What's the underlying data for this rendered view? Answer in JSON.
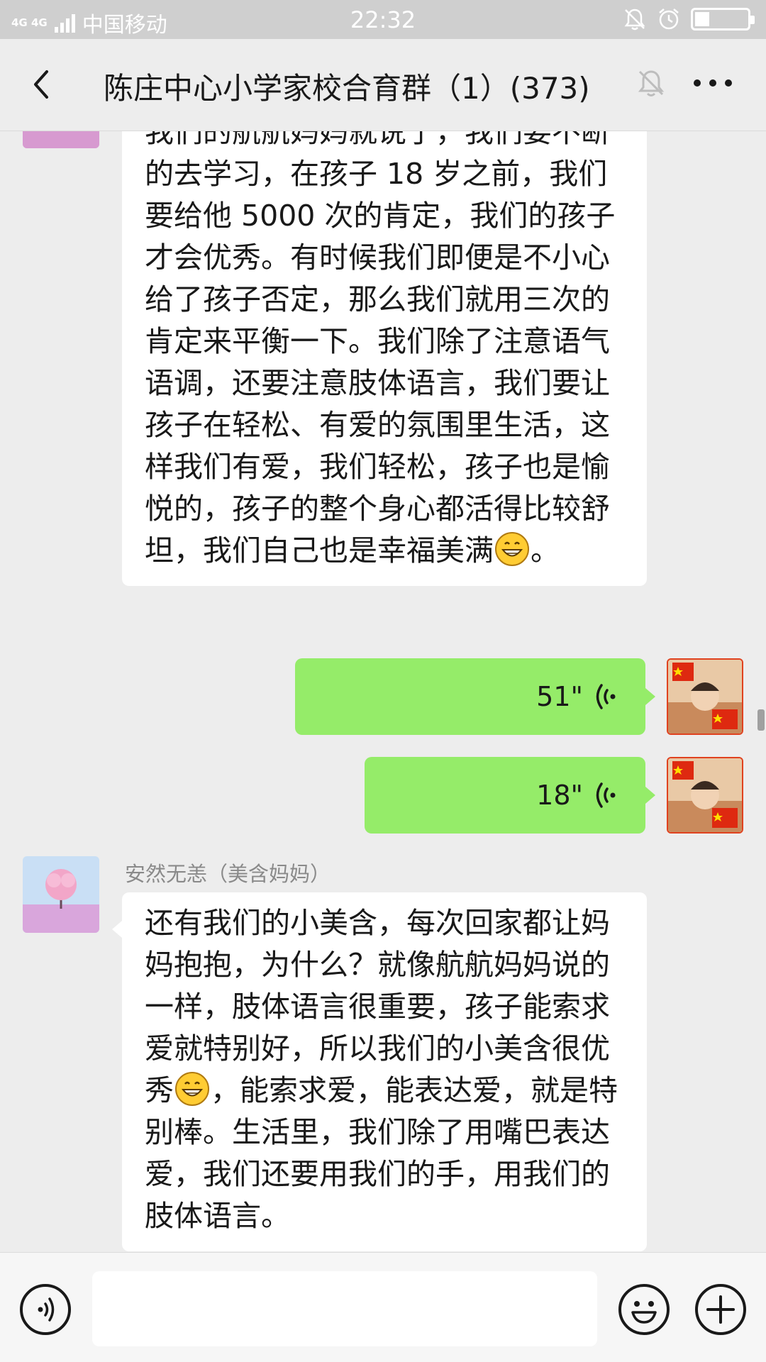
{
  "status_bar": {
    "network": "4G 4G",
    "carrier": "中国移动",
    "time": "22:32",
    "icons": [
      "signal-icon",
      "bell-muted-icon",
      "alarm-icon",
      "battery-icon"
    ],
    "battery_level": 0.2
  },
  "header": {
    "title": "陈庄中心小学家校合育群（1）(373)",
    "icons": [
      "back-icon",
      "mute-icon",
      "more-icon"
    ]
  },
  "messages": {
    "m1": {
      "type": "text-in",
      "lines_before_emoji": "我们的航航妈妈就说了，我们要不断的去学习，在孩子 18 岁之前，我们要给他 5000 次的肯定，我们的孩子才会优秀。有时候我们即便是不小心给了孩子否定，那么我们就用三次的肯定来平衡一下。我们除了注意语气语调，还要注意肢体语言，我们要让孩子在轻松、有爱的氛围里生活，这样我们有爱，我们轻松，孩子也是愉悦的，孩子的整个身心都活得比较舒坦，我们自己也是幸福美满",
      "after_emoji": "。"
    },
    "m2": {
      "type": "voice-out",
      "duration": "51\""
    },
    "m3": {
      "type": "voice-out",
      "duration": "18\""
    },
    "m4": {
      "type": "text-in",
      "sender": "安然无恙（美含妈妈）",
      "before_emoji": "还有我们的小美含，每次回家都让妈妈抱抱，为什么？就像航航妈妈说的一样，肢体语言很重要，孩子能索求爱就特别好，所以我们的小美含很优秀",
      "after_emoji": "，能索求爱，能表达爱，就是特别棒。生活里，我们除了用嘴巴表达爱，我们还要用我们的手，用我们的肢体语言。"
    }
  },
  "input_bar": {
    "placeholder": "",
    "icons": [
      "voice-input-icon",
      "emoji-icon",
      "plus-icon"
    ]
  },
  "colors": {
    "outgoing_bubble": "#95ec69",
    "incoming_bubble": "#ffffff",
    "background": "#ededed",
    "status_bar": "#cfcfcf"
  }
}
